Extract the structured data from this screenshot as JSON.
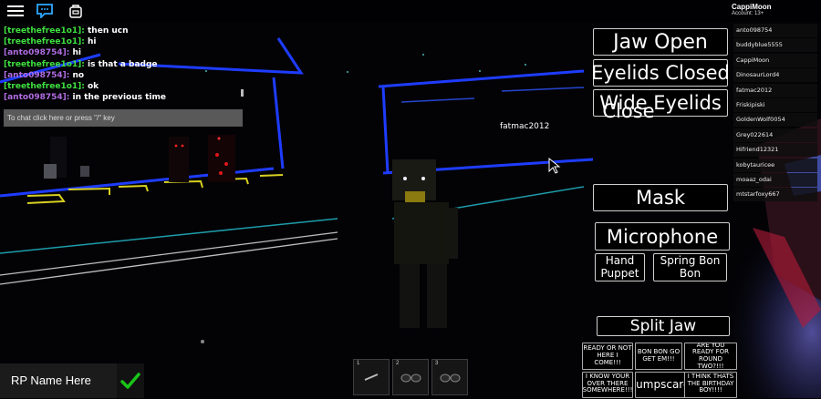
{
  "topbar": {
    "menu_icon": "hamburger-menu-icon",
    "chat_icon": "chat-bubble-icon",
    "backpack_icon": "backpack-icon",
    "account_name": "CappiMoon",
    "account_sub": "Account: 13+"
  },
  "chat": {
    "messages": [
      {
        "user": "[treethefree1o1]:",
        "text": "then ucn",
        "color": "green"
      },
      {
        "user": "[treethefree1o1]:",
        "text": "hi",
        "color": "green"
      },
      {
        "user": "[anto098754]:",
        "text": "hi",
        "color": "purple"
      },
      {
        "user": "[treethefree1o1]:",
        "text": "is that a badge",
        "color": "green"
      },
      {
        "user": "[anto098754]:",
        "text": "no",
        "color": "purple"
      },
      {
        "user": "[treethefree1o1]:",
        "text": "ok",
        "color": "green"
      },
      {
        "user": "[anto098754]:",
        "text": "in the previous time",
        "color": "purple"
      }
    ],
    "input_placeholder": "To chat click here or press \"/\" key"
  },
  "player_list": [
    "anto098754",
    "buddyblue5555",
    "CappiMoon",
    "DinosaurLord4",
    "fatmac2012",
    "Friskipiski",
    "GoldenWolf0054",
    "Grey022614",
    "Hifriend12321",
    "kobytauricee",
    "moaaz_odai",
    "mtstarfoxy667"
  ],
  "controls": {
    "jaw_open": "Jaw Open",
    "eyelids_closed": "Eyelids Closed",
    "wide_eyelids": "Wide Eyelids",
    "close": "Close",
    "mask": "Mask",
    "microphone": "Microphone",
    "hand_puppet": "Hand Puppet",
    "spring_bon_bon": "Spring Bon Bon",
    "split_jaw": "Split Jaw"
  },
  "voice_lines": {
    "ready": "READY OR NOT HERE I COME!!!",
    "bonbon": "BON BON GO GET EM!!!",
    "round_two": "ARE YOU READY FOR ROUND TWO?!!!",
    "over_there": "I KNOW YOUR OVER THERE SOMEWHERE!!!",
    "jumpscare": "Jumpscare",
    "birthday": "I THINK THATS THE BIRTHDAY BOY!!!!"
  },
  "world": {
    "nametag": "fatmac2012"
  },
  "rp_name": {
    "label": "RP Name Here",
    "confirm_icon": "checkmark-icon"
  },
  "hotbar": {
    "slots": [
      "1",
      "2",
      "3"
    ]
  },
  "colors": {
    "neon_blue": "#1e3cff",
    "chat_green": "#3fe03f",
    "chat_purple": "#b06ce0",
    "check_green": "#19c419"
  }
}
